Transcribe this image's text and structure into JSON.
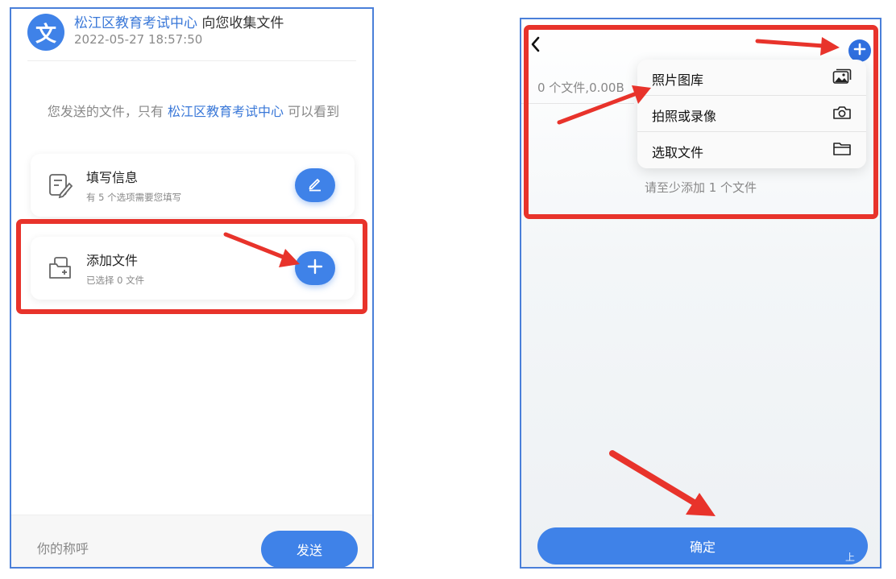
{
  "left": {
    "header": {
      "avatar_glyph": "文",
      "org": "松江区教育考试中心",
      "title_suffix": " 向您收集文件",
      "timestamp": "2022-05-27 18:57:50"
    },
    "notice": {
      "prefix": "您发送的文件，只有 ",
      "org": "松江区教育考试中心",
      "suffix": " 可以看到"
    },
    "fill_card": {
      "title": "填写信息",
      "subtitle": "有 5 个选项需要您填写"
    },
    "add_card": {
      "title": "添加文件",
      "subtitle": "已选择 0 文件"
    },
    "footer": {
      "name_placeholder": "你的称呼",
      "send_label": "发送"
    }
  },
  "right": {
    "file_count": "0 个文件,0.00B",
    "menu": {
      "items": [
        {
          "label": "照片图库",
          "icon": "photo-library-icon"
        },
        {
          "label": "拍照或录像",
          "icon": "camera-icon"
        },
        {
          "label": "选取文件",
          "icon": "folder-icon"
        }
      ]
    },
    "min_hint": "请至少添加 1 个文件",
    "confirm_label": "确定",
    "watermark": "上"
  },
  "colors": {
    "accent": "#3f82e8",
    "highlight": "#e8332b",
    "frame": "#4a7fd9"
  }
}
